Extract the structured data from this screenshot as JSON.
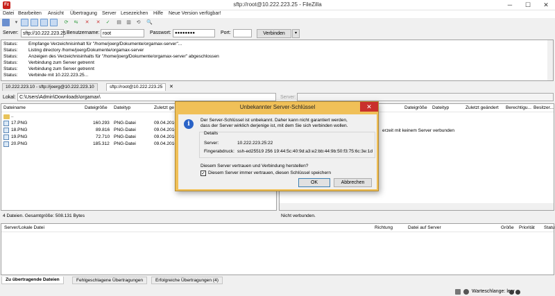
{
  "window": {
    "title": "sftp://root@10.222.223.25 - FileZilla",
    "app_icon": "Fz"
  },
  "menu": [
    "Datei",
    "Bearbeiten",
    "Ansicht",
    "Übertragung",
    "Server",
    "Lesezeichen",
    "Hilfe",
    "Neue Version verfügbar!"
  ],
  "quickconnect": {
    "server_label": "Server:",
    "server_value": "sftp://10.222.223.25",
    "user_label": "Benutzername:",
    "user_value": "root",
    "password_label": "Passwort:",
    "password_value": "●●●●●●●●",
    "port_label": "Port:",
    "port_value": "",
    "connect_label": "Verbinden",
    "dropdown": "▾"
  },
  "log": [
    {
      "k": "Status:",
      "v": "Empfange Verzeichnisinhalt für \"/home/joerg/Dokumente/orgamax-server\"..."
    },
    {
      "k": "Status:",
      "v": "Listing directory /home/joerg/Dokumente/orgamax-server"
    },
    {
      "k": "Status:",
      "v": "Anzeigen des Verzeichnisinhalts für \"/home/joerg/Dokumente/orgamax-server\" abgeschlossen"
    },
    {
      "k": "Status:",
      "v": "Verbindung zum Server getrennt"
    },
    {
      "k": "Status:",
      "v": "Verbindung zum Server getrennt"
    },
    {
      "k": "Status:",
      "v": "Verbinde mit 10.222.223.25..."
    }
  ],
  "tabs": [
    "10.222.223.10 - sftp://joerg@10.222.223.10",
    "sftp://root@10.222.223.25"
  ],
  "local": {
    "path_label": "Lokal:",
    "path_value": "C:\\Users\\Admin\\Downloads\\orgamax\\",
    "headers": [
      "Dateiname",
      "Dateigröße",
      "Dateityp",
      "Zuletzt ge"
    ],
    "rows": [
      {
        "name": "..",
        "size": "",
        "type": "",
        "date": ""
      },
      {
        "name": "17.PNG",
        "size": "160.293",
        "type": "PNG-Datei",
        "date": "09.04.2016"
      },
      {
        "name": "18.PNG",
        "size": "89.816",
        "type": "PNG-Datei",
        "date": "09.04.2016"
      },
      {
        "name": "19.PNG",
        "size": "72.710",
        "type": "PNG-Datei",
        "date": "09.04.2016"
      },
      {
        "name": "20.PNG",
        "size": "185.312",
        "type": "PNG-Datei",
        "date": "09.04.2016"
      }
    ],
    "status": "4 Dateien. Gesamtgröße: 508.131 Bytes"
  },
  "remote": {
    "path_label": "Server:",
    "headers": [
      "Dateigröße",
      "Dateityp",
      "Zuletzt geändert",
      "Berechtigu...",
      "Besitzer..."
    ],
    "message": "erzeit mit keinem Server verbunden",
    "status": "Nicht verbunden."
  },
  "queue": {
    "headers": [
      "Server/Lokale Datei",
      "Richtung",
      "Datei auf Server",
      "Größe",
      "Priorität",
      "Status"
    ],
    "tabs": [
      "Zu übertragende Dateien",
      "Fehlgeschlagene Übertragungen",
      "Erfolgreiche Übertragungen (4)"
    ]
  },
  "statusbar": {
    "queue": "Warteschlange: leer"
  },
  "dialog": {
    "title": "Unbekannter Server-Schlüssel",
    "line1": "Der Server-Schlüssel ist unbekannt. Daher kann nicht garantiert werden,",
    "line2": "dass der Server wirklich derjenige ist, mit dem Sie sich verbinden wollen.",
    "details_label": "Details",
    "server_label": "Server:",
    "server_value": "10.222.223.25:22",
    "fp_label": "Fingerabdruck:",
    "fp_value": "ssh-ed25519 256 19:44:5c:40:9d:a3:e2:bb:44:9b:50:f3:75:6c:3e:1d",
    "question": "Diesem Server vertrauen und Verbindung herstellen?",
    "checkbox_label": "Diesem Server immer vertrauen, diesen Schlüssel speichern",
    "ok": "OK",
    "cancel": "Abbrechen"
  }
}
